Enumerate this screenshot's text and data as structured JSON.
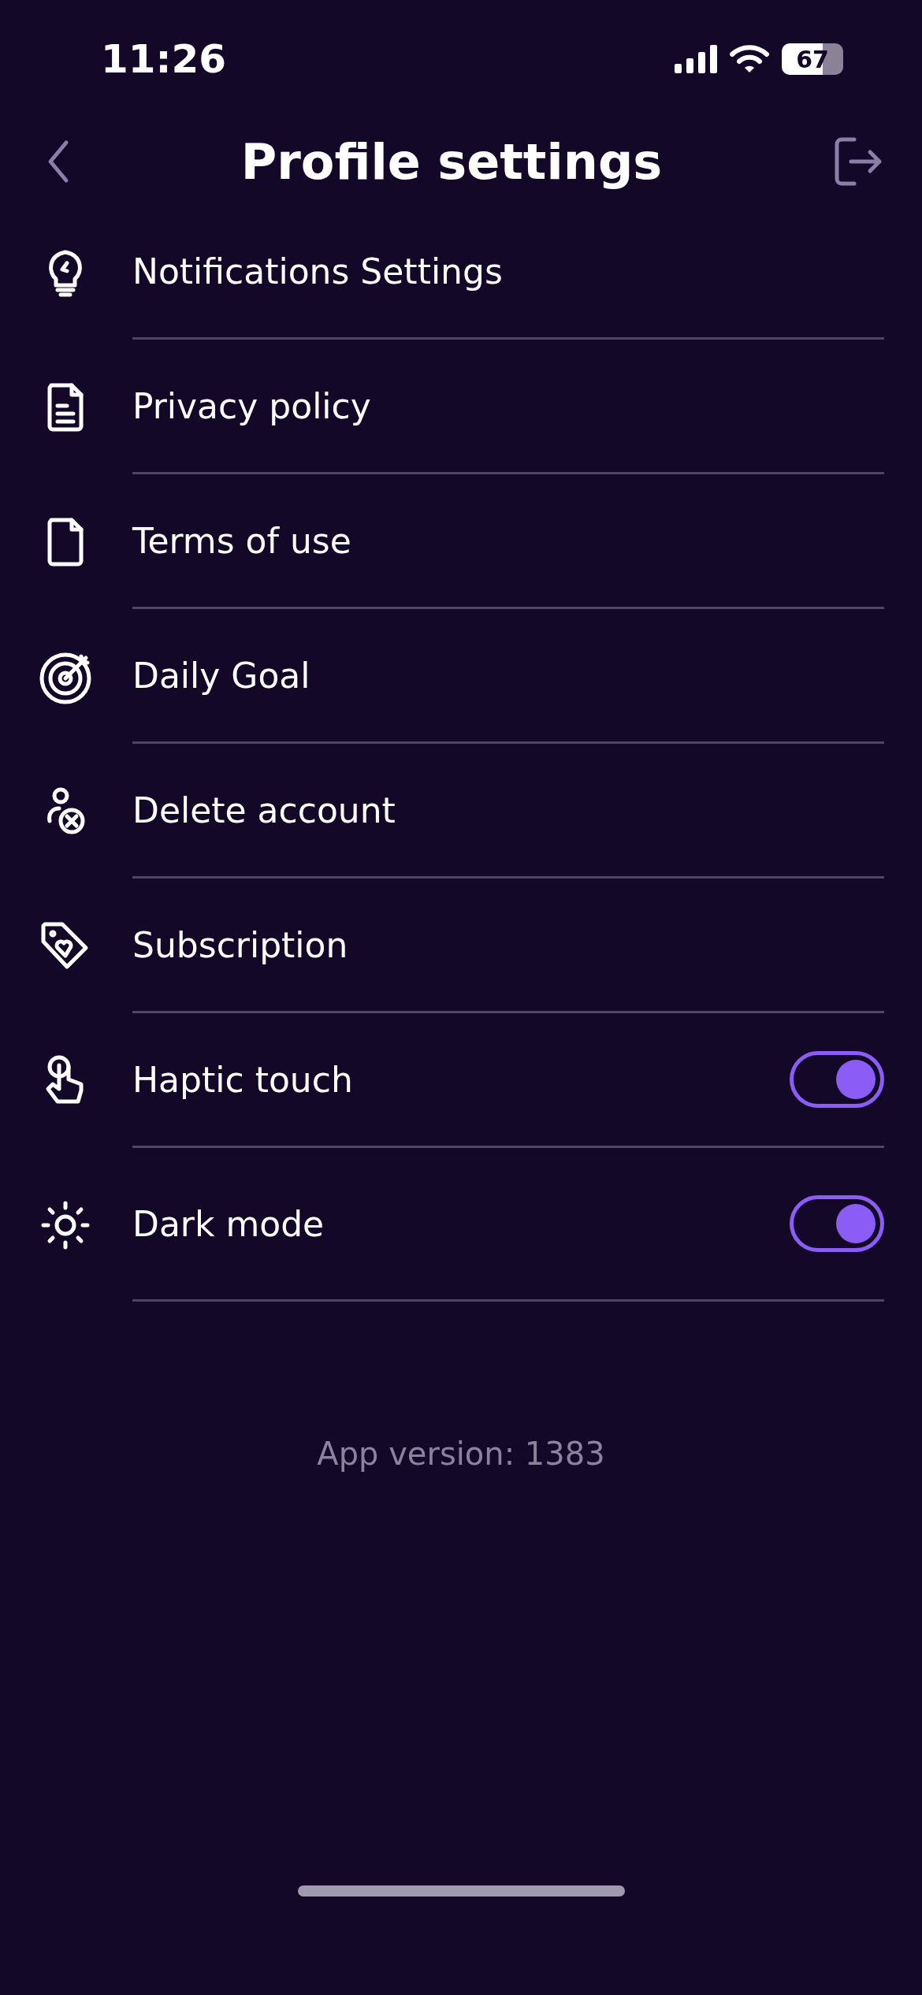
{
  "status_bar": {
    "time": "11:26",
    "battery": "67"
  },
  "header": {
    "title": "Profile settings"
  },
  "items": [
    {
      "kind": "link",
      "label": "Notifications Settings"
    },
    {
      "kind": "link",
      "label": "Privacy policy"
    },
    {
      "kind": "link",
      "label": "Terms of use"
    },
    {
      "kind": "link",
      "label": "Daily Goal"
    },
    {
      "kind": "link",
      "label": "Delete account"
    },
    {
      "kind": "link",
      "label": "Subscription"
    },
    {
      "kind": "toggle",
      "label": "Haptic touch",
      "on": true
    },
    {
      "kind": "toggle",
      "label": "Dark mode",
      "on": true
    }
  ],
  "footer": {
    "version": "App version: 1383"
  }
}
